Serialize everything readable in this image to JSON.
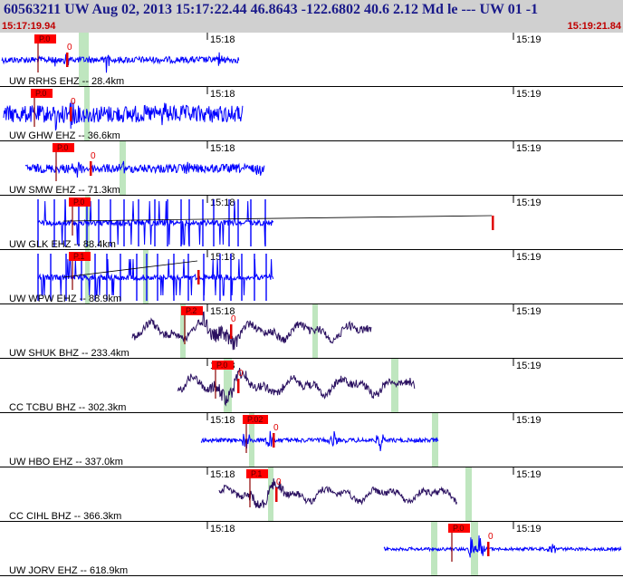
{
  "header": {
    "title": "60563211 UW Aug 02, 2013 15:17:22.44   46.8643 -122.6802 40.6 2.12 Md le --- UW 01   -1",
    "time_start": "15:17:19.94",
    "time_end": "15:19:21.84"
  },
  "colors": {
    "short_period_trace": "#0000ff",
    "broadband_trace": "#2a1060",
    "pick_box": "#ff0000",
    "pick_tick": "#e00000",
    "highlight_band": "#bfe6bf",
    "separator": "#000000",
    "header_bg": "#d0d0d0"
  },
  "minute_labels": [
    "15:18",
    "15:19"
  ],
  "channels": [
    {
      "label": "UW RRHS EHZ -- 28.4km",
      "type": "short-period",
      "phase": "P.0",
      "pick_marker": "0"
    },
    {
      "label": "UW GHW EHZ -- 36.6km",
      "type": "short-period",
      "phase": "P.0",
      "pick_marker": "0"
    },
    {
      "label": "UW SMW EHZ -- 71.3km",
      "type": "short-period",
      "phase": "P.0",
      "pick_marker": "0"
    },
    {
      "label": "UW GLK EHZ -- 88.4km",
      "type": "clipped",
      "phase": "P.0",
      "pick_marker": ""
    },
    {
      "label": "UW WPW EHZ -- 88.9km",
      "type": "clipped",
      "phase": "P.1",
      "pick_marker": ""
    },
    {
      "label": "UW SHUK BHZ -- 233.4km",
      "type": "broadband",
      "phase": "P.2",
      "pick_marker": "0"
    },
    {
      "label": "CC TCBU BHZ -- 302.3km",
      "type": "broadband",
      "phase": "P.0",
      "pick_marker": "0"
    },
    {
      "label": "UW HBO EHZ -- 337.0km",
      "type": "short-period",
      "phase": "P.02",
      "pick_marker": "0"
    },
    {
      "label": "CC CIHL BHZ -- 366.3km",
      "type": "broadband",
      "phase": "P.1",
      "pick_marker": "0"
    },
    {
      "label": "UW JORV EHZ -- 618.9km",
      "type": "short-period",
      "phase": "P.0",
      "pick_marker": "0"
    }
  ]
}
